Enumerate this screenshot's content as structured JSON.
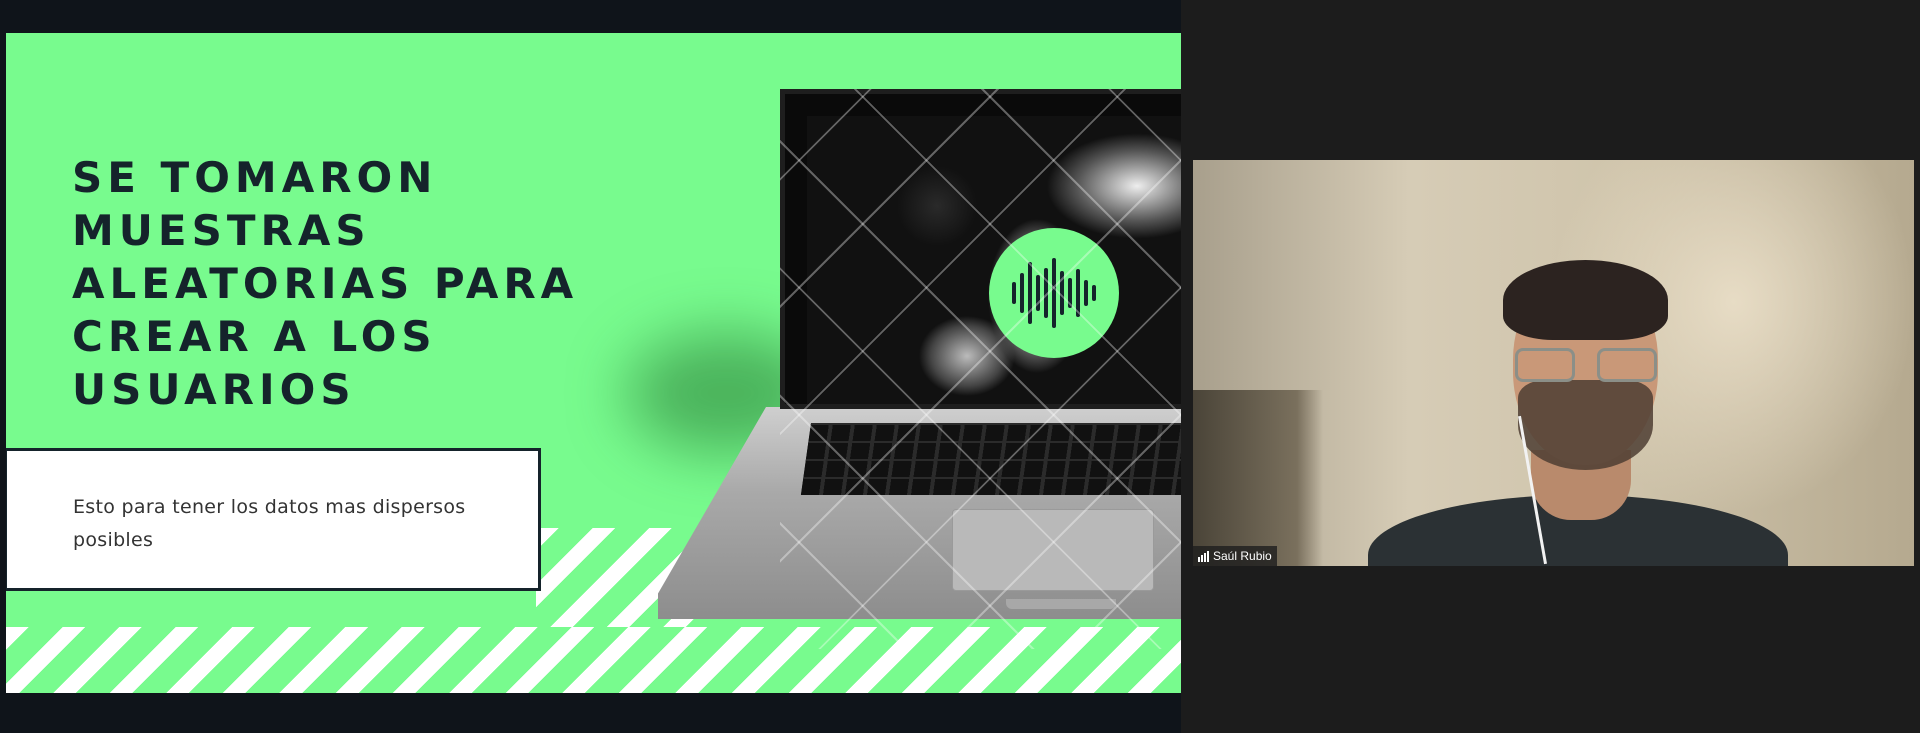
{
  "slide": {
    "title": "Se tomaron muestras aleatorias para crear a los usuarios",
    "body": "Esto para tener los datos mas dispersos posibles",
    "accent_color": "#78fb8e",
    "ink_color": "#15232b"
  },
  "video": {
    "participant_name": "Saúl Rubio"
  },
  "icons": {
    "audio": "audio-waveform-icon",
    "signal": "signal-strength-icon"
  }
}
